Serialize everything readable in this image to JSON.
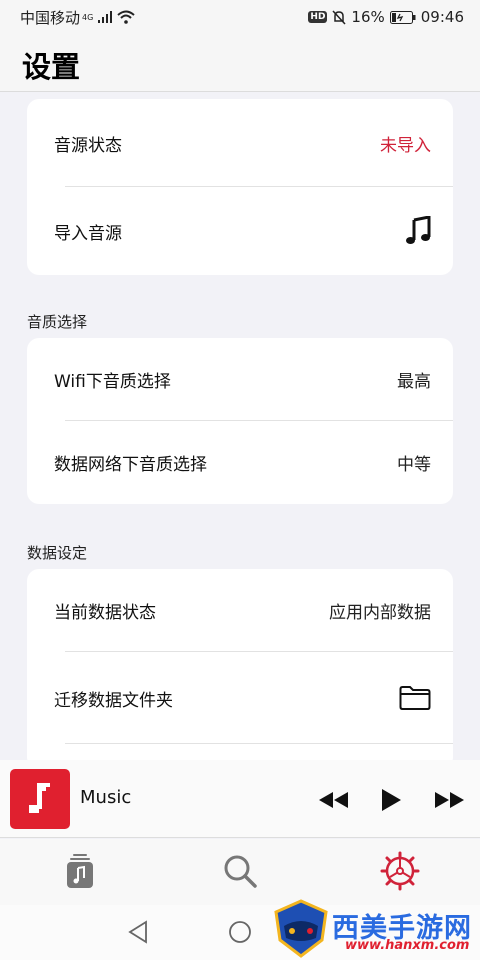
{
  "status_bar": {
    "carrier": "中国移动",
    "network": "4G",
    "battery": "16%",
    "time": "09:46",
    "hd": "HD"
  },
  "header": {
    "title": "设置"
  },
  "card_source": {
    "rows": [
      {
        "label": "音源状态",
        "value": "未导入"
      },
      {
        "label": "导入音源",
        "icon": "music-note-icon"
      }
    ]
  },
  "section_quality": {
    "label": "音质选择",
    "rows": [
      {
        "label": "Wifi下音质选择",
        "value": "最高"
      },
      {
        "label": "数据网络下音质选择",
        "value": "中等"
      }
    ]
  },
  "section_data": {
    "label": "数据设定",
    "rows": [
      {
        "label": "当前数据状态",
        "value": "应用内部数据"
      },
      {
        "label": "迁移数据文件夹",
        "icon": "folder-icon"
      }
    ]
  },
  "player": {
    "track_title": "Music"
  },
  "tabs": [
    {
      "name": "library",
      "icon": "library-icon",
      "active": false
    },
    {
      "name": "search",
      "icon": "search-icon",
      "active": false
    },
    {
      "name": "settings",
      "icon": "settings-icon",
      "active": true
    }
  ],
  "watermark": {
    "text": "西美手游网",
    "url": "www.hanxm.com"
  },
  "colors": {
    "accent": "#d0233a",
    "background": "#f2f2f7",
    "card": "#ffffff"
  }
}
